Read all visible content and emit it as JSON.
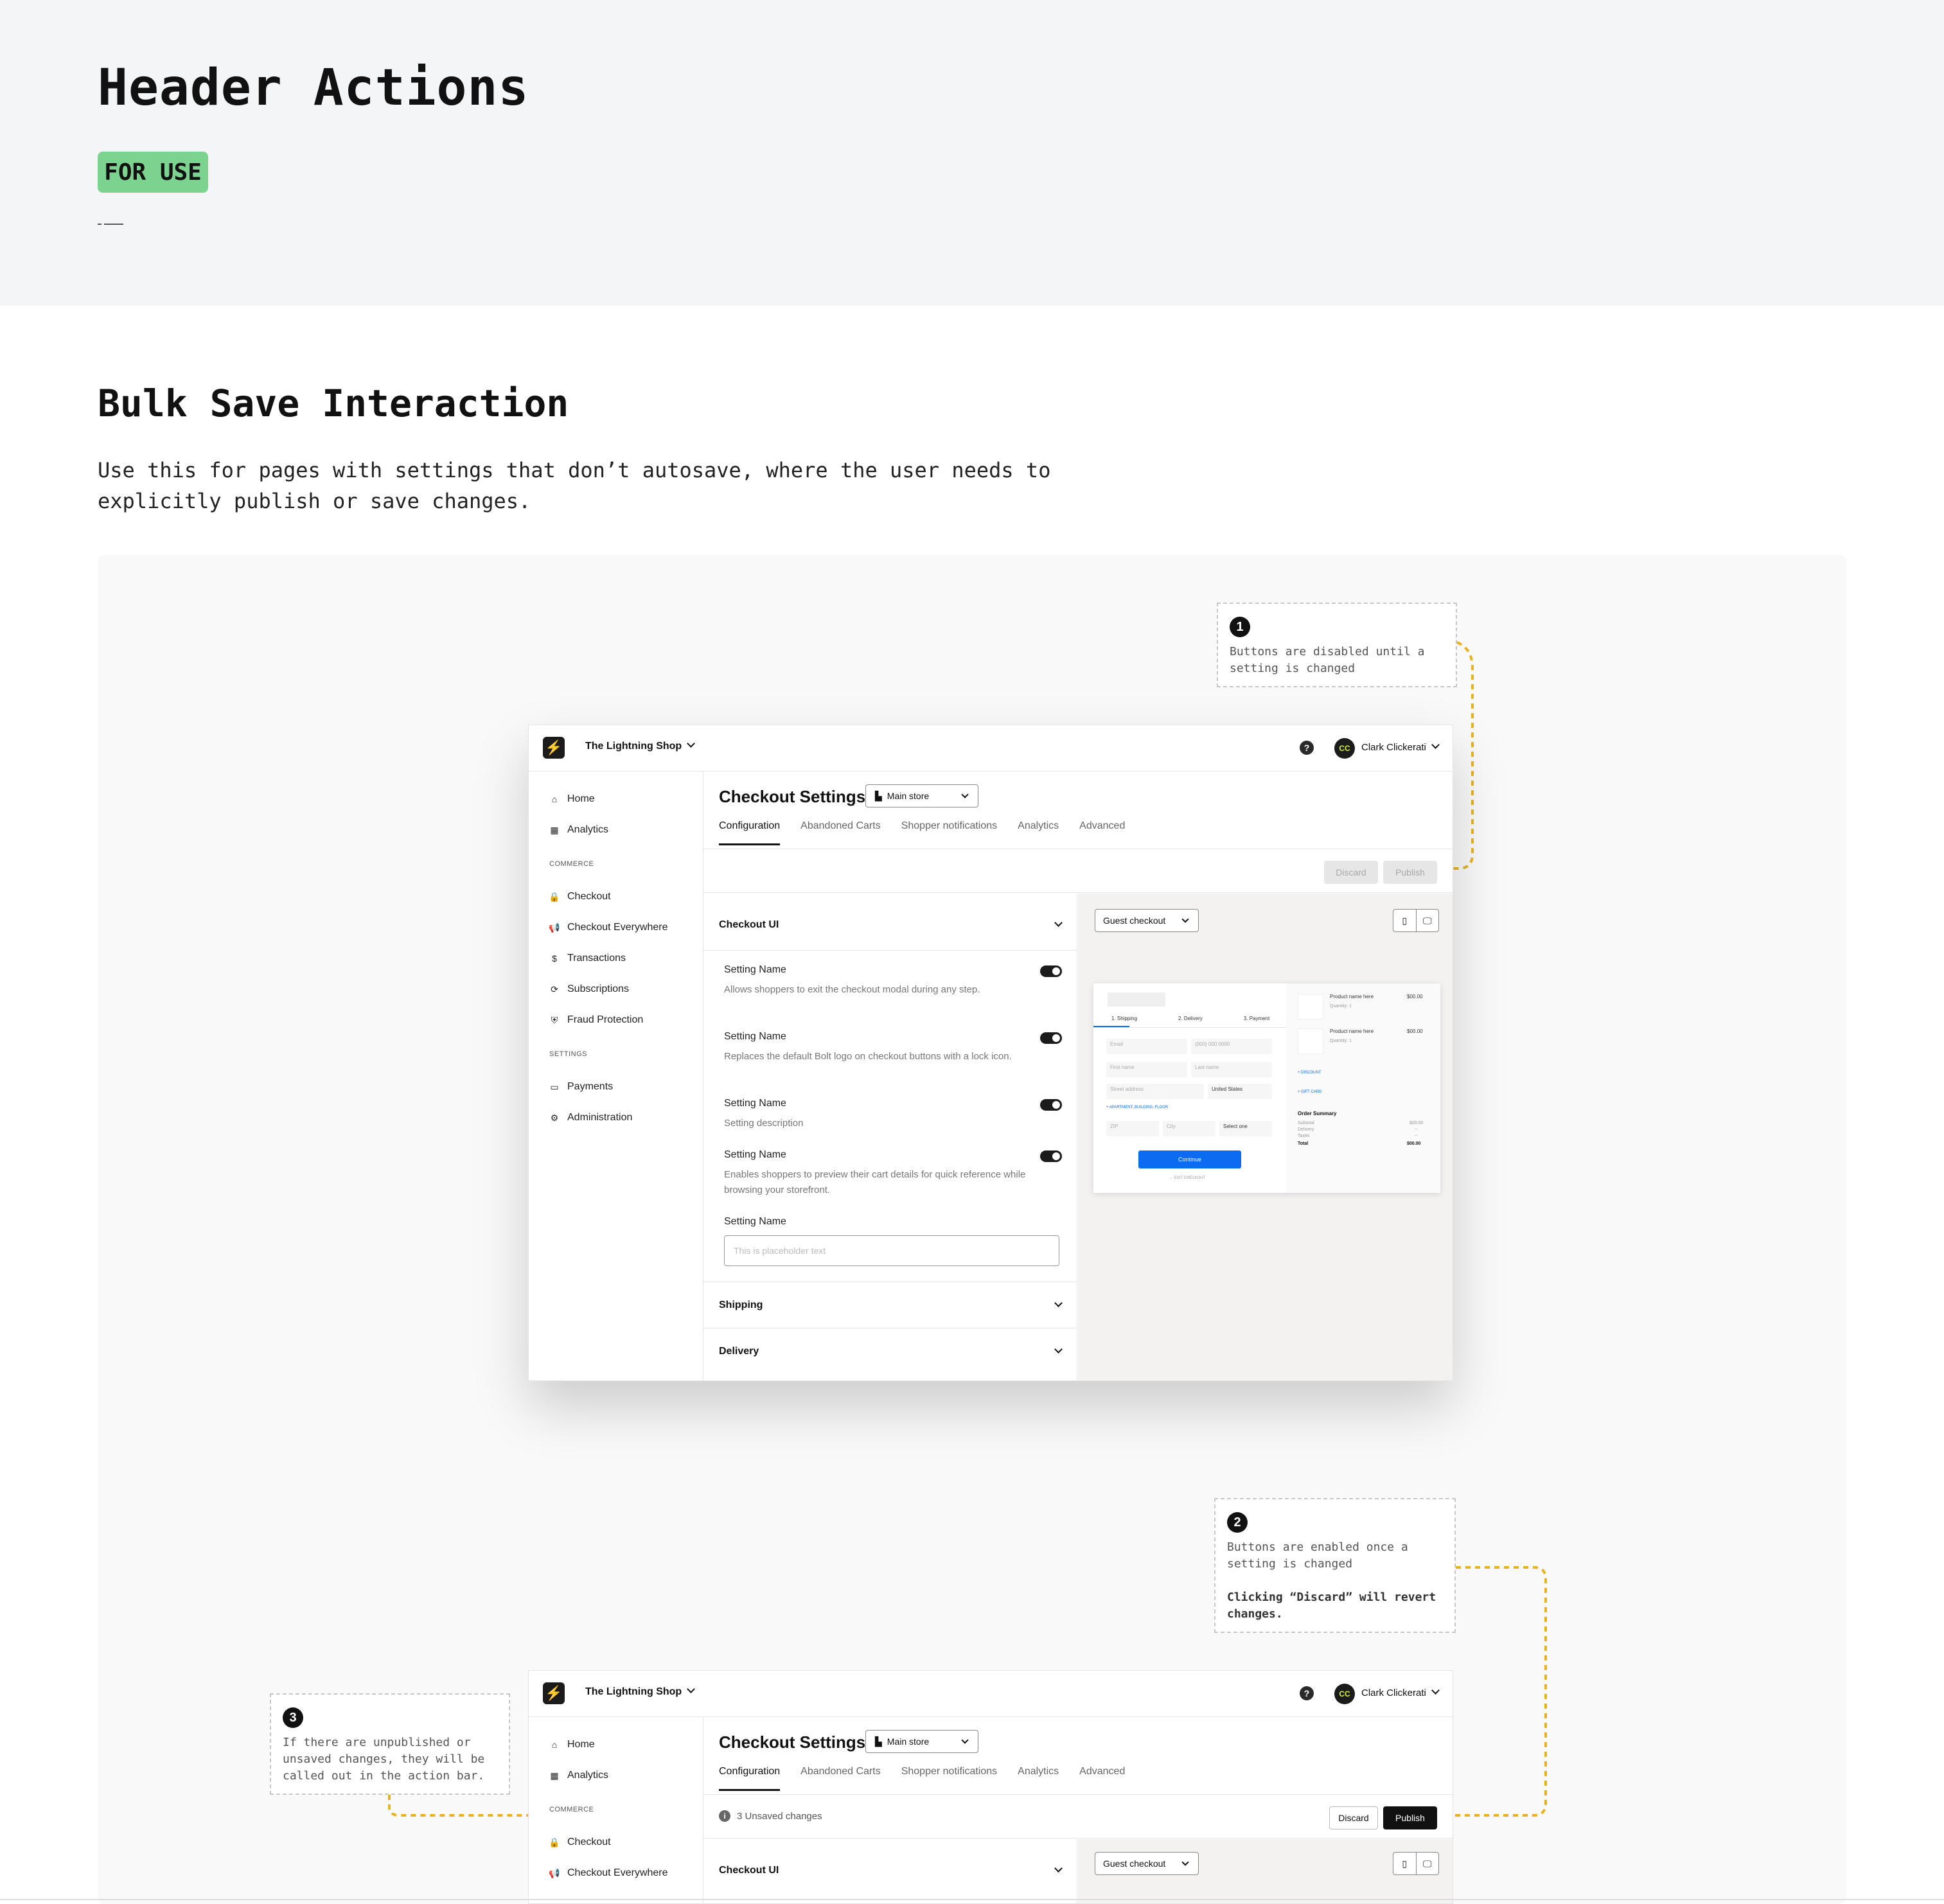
{
  "page": {
    "title": "Header Actions",
    "badge": "FOR USE",
    "section_title": "Bulk Save Interaction",
    "section_desc": "Use this for pages with settings that don’t autosave, where the user needs to explicitly publish or save changes."
  },
  "notes": {
    "n1": {
      "num": "1",
      "text": "Buttons are disabled until a setting is changed"
    },
    "n2": {
      "num": "2",
      "text": "Buttons are enabled once a setting is changed",
      "bold": "Clicking “Discard” will revert changes."
    },
    "n3": {
      "num": "3",
      "text": "If there are unpublished or unsaved changes, they will be called out in the action bar."
    }
  },
  "app": {
    "shop_name": "The Lightning Shop",
    "user_initials": "CC",
    "user_name": "Clark Clickerati",
    "help": "?",
    "sidebar": {
      "home": "Home",
      "analytics": "Analytics",
      "commerce_label": "COMMERCE",
      "checkout": "Checkout",
      "checkout_everywhere": "Checkout Everywhere",
      "transactions": "Transactions",
      "subscriptions": "Subscriptions",
      "fraud": "Fraud Protection",
      "settings_label": "SETTINGS",
      "payments": "Payments",
      "administration": "Administration"
    },
    "page_title": "Checkout Settings",
    "store_select": "Main store",
    "tabs": [
      "Configuration",
      "Abandoned Carts",
      "Shopper notifications",
      "Analytics",
      "Advanced"
    ],
    "discard": "Discard",
    "publish": "Publish",
    "unsaved": "3 Unsaved changes",
    "checkout_ui": "Checkout UI",
    "shipping": "Shipping",
    "delivery": "Delivery",
    "settings": [
      {
        "name": "Setting Name",
        "desc": "Allows shoppers to exit the checkout modal during any step."
      },
      {
        "name": "Setting Name",
        "desc": "Replaces the default Bolt logo on checkout buttons with a lock icon."
      },
      {
        "name": "Setting Name",
        "desc": "Setting description"
      },
      {
        "name": "Setting Name",
        "desc": "Enables shoppers to preview their cart details for quick reference while browsing your storefront."
      },
      {
        "name": "Setting Name",
        "desc": ""
      }
    ],
    "placeholder": "This is placeholder text",
    "guest_checkout": "Guest checkout",
    "preview": {
      "steps": [
        "1. Shipping",
        "2. Delivery",
        "3. Payment"
      ],
      "email": "Email",
      "phone_label": "Phone number",
      "phone": "(000) 000 0000",
      "first": "First name",
      "last": "Last name",
      "street": "Street address",
      "country_label": "Country",
      "country": "United States",
      "apt": "+ APARTMENT, BUILDING, FLOOR",
      "zip": "ZIP",
      "city": "City",
      "state_label": "State",
      "state": "Select one",
      "continue": "Continue",
      "exit": "← EXIT CHECKOUT",
      "product": "Product name here",
      "qty": "Quantity: 1",
      "price": "$00.00",
      "discount": "+ DISCOUNT",
      "gift": "+ GIFT CARD",
      "summary": "Order Summary",
      "subtotal": "Subtotal",
      "delivery": "Delivery",
      "taxes": "Taxes",
      "total": "Total",
      "dashes": "--"
    }
  },
  "colors": {
    "badge": "#7bd38f",
    "connector": "#e8b21f",
    "brand_dark": "#1b1b1b",
    "brand_accent": "#d7f233",
    "continue_btn": "#0b6cf2"
  }
}
